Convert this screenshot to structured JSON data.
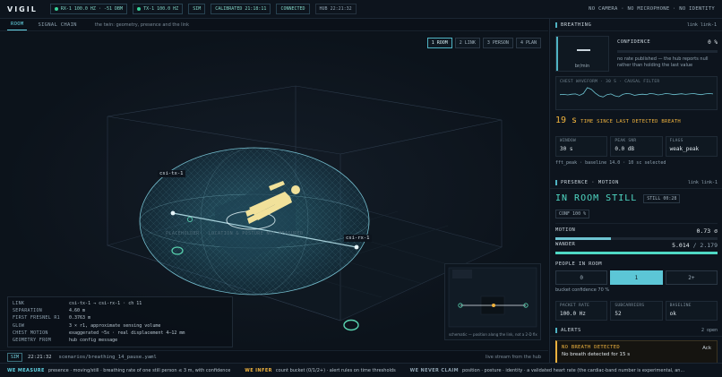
{
  "app": {
    "brand": "VIGIL",
    "chips": {
      "rx": "RX-1 100.0 HZ · -51 DBM",
      "tx": "TX-1 100.0 HZ",
      "sim": "SIM",
      "calibrated": "CALIBRATED 21:18:11",
      "connected": "CONNECTED",
      "hub": "HUB 22:21:32"
    },
    "privacy": "NO CAMERA · NO MICROPHONE · NO IDENTITY"
  },
  "tabs": {
    "room": "ROOM",
    "signal_chain": "SIGNAL CHAIN",
    "description": "the twin: geometry, presence and the link"
  },
  "views": {
    "one_room": "1 ROOM",
    "two_link": "2 LINK",
    "three_person": "3 PERSON",
    "four_plan": "4 PLAN"
  },
  "scene": {
    "tx_label": "csi-tx-1",
    "rx_label": "csi-rx-1",
    "placeholder": "PLACEHOLDER · LOCATION & POSTURE NOT MEASURED",
    "schematic_caption": "schematic — position along the link, not a 2-D fix"
  },
  "legend": [
    {
      "k": "LINK",
      "v": "csi-tx-1 → csi-rx-1 · ch 11"
    },
    {
      "k": "SEPARATION",
      "v": "4.60 m"
    },
    {
      "k": "FIRST FRESNEL R1",
      "v": "0.3763 m"
    },
    {
      "k": "GLOW",
      "v": "3 × r1, approximate sensing volume"
    },
    {
      "k": "CHEST MOTION",
      "v": "exaggerated ~5x · real displacement 4–12 mm"
    },
    {
      "k": "GEOMETRY FROM",
      "v": "hub config message"
    }
  ],
  "status": {
    "sim": "SIM",
    "time": "22:21:32",
    "file": "scenarios/breathing_14_pause.yaml",
    "live": "live stream from the hub"
  },
  "footer": {
    "measure_h": "WE MEASURE",
    "measure": "presence · moving/still · breathing rate of one still person ≤ 3 m, with confidence",
    "infer_h": "WE INFER",
    "infer": "count bucket (0/1/2+) · alert rules on time thresholds",
    "claim_h": "WE NEVER CLAIM",
    "claim": "position · posture · identity · a validated heart rate (the cardiac-band number is experimental, an..."
  },
  "breathing": {
    "title": "BREATHING",
    "link": "link link-1",
    "rate_value": "—",
    "rate_unit": "br/min",
    "confidence_label": "CONFIDENCE",
    "confidence_value": "0 %",
    "confidence_fraction": 0,
    "note": "no rate published — the hub reports null rather than holding the last value",
    "waveform_caption": "CHEST WAVEFORM · 30 S · CAUSAL FILTER",
    "waveform": [
      0.55,
      0.56,
      0.54,
      0.57,
      0.58,
      0.52,
      0.6,
      0.85,
      0.78,
      0.62,
      0.5,
      0.45,
      0.55,
      0.58,
      0.5,
      0.46,
      0.56,
      0.6,
      0.58,
      0.52,
      0.55,
      0.57,
      0.55,
      0.6,
      0.58,
      0.54,
      0.56,
      0.6,
      0.58,
      0.55,
      0.57,
      0.59,
      0.56,
      0.58,
      0.6,
      0.57,
      0.55,
      0.58,
      0.6,
      0.58
    ],
    "since_value": "19 s",
    "since_label": "TIME SINCE LAST DETECTED BREATH",
    "stats": [
      {
        "k": "WINDOW",
        "v": "30 s"
      },
      {
        "k": "PEAK SNR",
        "v": "0.0 dB"
      },
      {
        "k": "FLAGS",
        "v": "weak_peak"
      }
    ],
    "fft_note": "fft_peak · baseline 14.0 · 10 sc selected"
  },
  "presence": {
    "title": "PRESENCE · MOTION",
    "link": "link link-1",
    "state": "IN ROOM STILL",
    "still": "STILL 00:28",
    "conf": "CONF 100 %",
    "motion_label": "MOTION",
    "motion_value": "0.73 σ",
    "motion_fraction": 0.34,
    "wander_label": "WANDER",
    "wander_value": "5.014",
    "wander_max": "/ 2.179",
    "wander_fraction": 1,
    "people_label": "PEOPLE IN ROOM",
    "buckets": [
      "0",
      "1",
      "2+"
    ],
    "selected_bucket": "1",
    "bucket_conf": "bucket confidence 70 %",
    "stats": [
      {
        "k": "PACKET RATE",
        "v": "100.0 Hz"
      },
      {
        "k": "SUBCARRIERS",
        "v": "52"
      },
      {
        "k": "BASELINE",
        "v": "ok"
      }
    ]
  },
  "alerts": {
    "title": "ALERTS",
    "count": "2 open",
    "item": {
      "title": "NO BREATH DETECTED",
      "desc": "No breath detected for 15 s",
      "ack": "Ack"
    }
  },
  "colors": {
    "accent": "#5cc6d6",
    "warn": "#f0b33e",
    "ok": "#37d39a",
    "bg": "#0b1119"
  }
}
